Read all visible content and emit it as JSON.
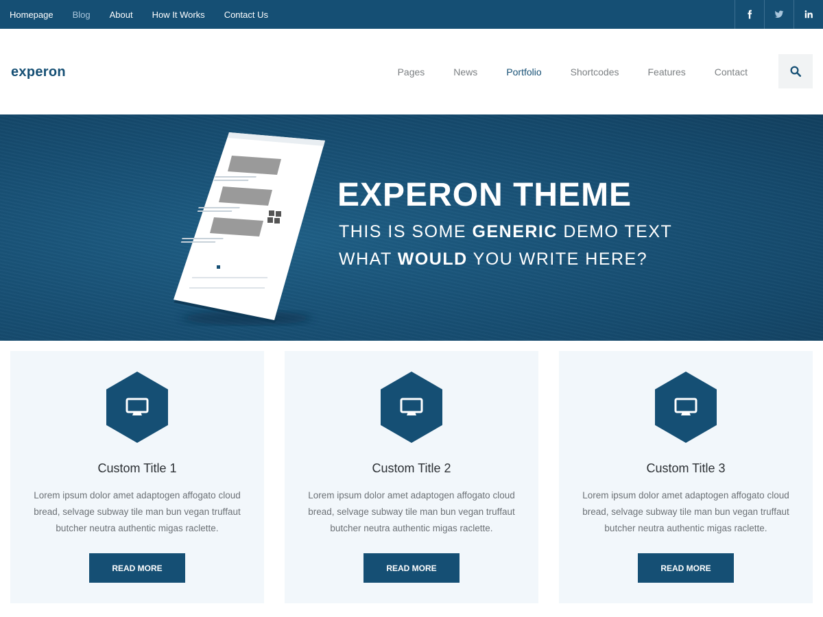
{
  "topbar": {
    "links": [
      "Homepage",
      "Blog",
      "About",
      "How It Works",
      "Contact Us"
    ],
    "active": "Blog",
    "social": [
      "facebook-icon",
      "twitter-icon",
      "linkedin-icon"
    ]
  },
  "header": {
    "logo": "experon",
    "nav": [
      "Pages",
      "News",
      "Portfolio",
      "Shortcodes",
      "Features",
      "Contact"
    ],
    "active": "Portfolio",
    "search_icon": "search-icon"
  },
  "hero": {
    "title": "EXPERON THEME",
    "line1_pre": "THIS IS SOME ",
    "line1_bold": "GENERIC",
    "line1_post": " DEMO TEXT",
    "line2_pre": "WHAT ",
    "line2_bold": "WOULD",
    "line2_post": " YOU WRITE HERE?"
  },
  "features": [
    {
      "icon": "desktop-icon",
      "title": "Custom Title 1",
      "text": "Lorem ipsum dolor amet adaptogen affogato cloud bread, selvage subway tile man bun vegan truffaut butcher neutra authentic migas raclette.",
      "button": "READ MORE"
    },
    {
      "icon": "desktop-icon",
      "title": "Custom Title 2",
      "text": "Lorem ipsum dolor amet adaptogen affogato cloud bread, selvage subway tile man bun vegan truffaut butcher neutra authentic migas raclette.",
      "button": "READ MORE"
    },
    {
      "icon": "desktop-icon",
      "title": "Custom Title 3",
      "text": "Lorem ipsum dolor amet adaptogen affogato cloud bread, selvage subway tile man bun vegan truffaut butcher neutra authentic migas raclette.",
      "button": "READ MORE"
    }
  ],
  "colors": {
    "brand": "#154f74",
    "card_bg": "#f2f7fb",
    "active_top": "#a9c6dc"
  }
}
